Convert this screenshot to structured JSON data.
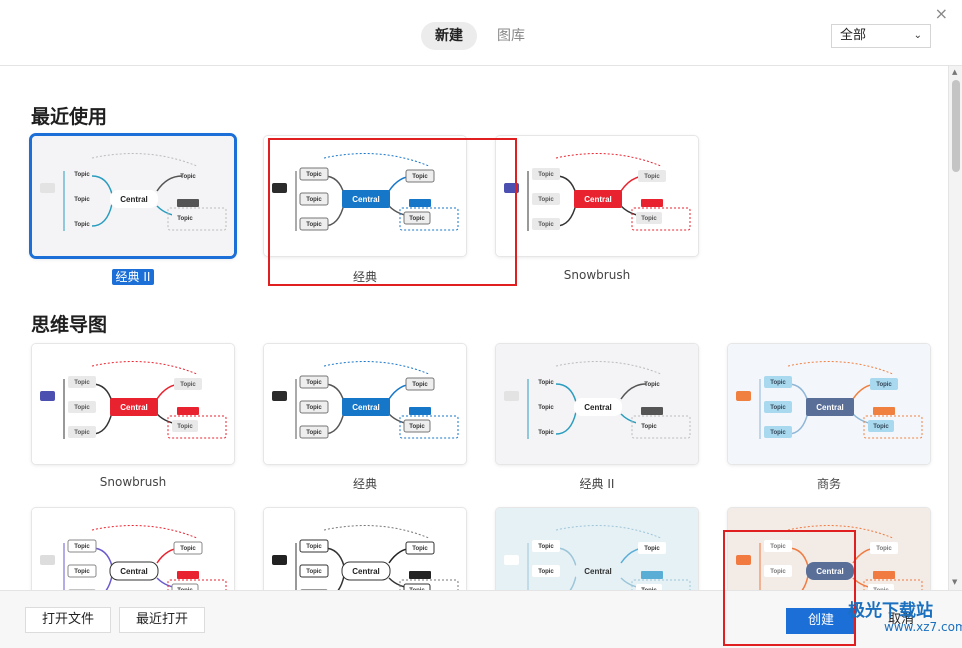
{
  "window": {
    "close_glyph": "×"
  },
  "tabs": {
    "new_label": "新建",
    "library_label": "图库"
  },
  "filter": {
    "value": "全部",
    "chevron_glyph": "⌄"
  },
  "sections": {
    "recent_title": "最近使用",
    "mindmap_title": "思维导图"
  },
  "recent_cards": [
    {
      "label": "经典 II",
      "style": "classic2",
      "selected": true
    },
    {
      "label": "经典",
      "style": "classic"
    },
    {
      "label": "Snowbrush",
      "style": "snowbrush"
    }
  ],
  "mindmap_cards": [
    {
      "label": "Snowbrush",
      "style": "snowbrush"
    },
    {
      "label": "经典",
      "style": "classic"
    },
    {
      "label": "经典 II",
      "style": "classic2"
    },
    {
      "label": "商务",
      "style": "business"
    }
  ],
  "more_cards": [
    {
      "label": "",
      "style": "colorful"
    },
    {
      "label": "",
      "style": "mono"
    },
    {
      "label": "",
      "style": "skyblue"
    },
    {
      "label": "",
      "style": "warm"
    }
  ],
  "thumbnail_text": {
    "central": "Central",
    "topic": "Topic",
    "subtopic": "Topic"
  },
  "bottom": {
    "open_file": "打开文件",
    "recent_open": "最近打开",
    "create": "创建",
    "cancel": "取消"
  },
  "watermark": {
    "brand": "极光下载站",
    "url": "www.xz7.com"
  },
  "colors": {
    "accent": "#1c6fd6",
    "annotation_red": "#e02020",
    "snowbrush_central": "#e8232f",
    "classic_central": "#1677c9",
    "business_central": "#5a6f98",
    "warm_central": "#5a6f98"
  }
}
